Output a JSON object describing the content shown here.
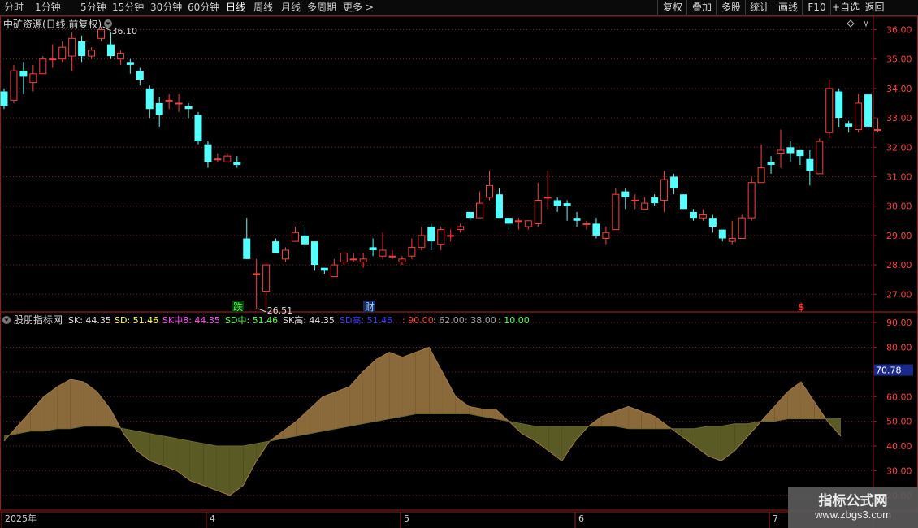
{
  "toolbar": {
    "periods": [
      "分时",
      "1分钟",
      "5分钟",
      "15分钟",
      "30分钟",
      "60分钟",
      "日线",
      "周线",
      "月线",
      "多周期",
      "更多 >"
    ],
    "active_period": "日线",
    "buttons": [
      "复权",
      "叠加",
      "多股",
      "统计",
      "画线",
      "F10",
      "+自选",
      "返回"
    ]
  },
  "main_panel": {
    "title": "中矿资源(日线,前复权)",
    "high_label": "36.10",
    "low_label": "26.51",
    "markers": {
      "die": "跌",
      "cai": "财",
      "dollar": "$"
    }
  },
  "indicator_panel": {
    "name": "股朋指标网",
    "legend": [
      {
        "text": "SK: 44.35",
        "color": "#e0e0e0"
      },
      {
        "text": "SD: 51.46",
        "color": "#ffff4f"
      },
      {
        "text": "SK中8: 44.35",
        "color": "#ff4fff"
      },
      {
        "text": "SD中: 51.46",
        "color": "#4fff4f"
      },
      {
        "text": "SK高: 44.35",
        "color": "#e0e0e0"
      },
      {
        "text": "SD高: 51.46",
        "color": "#3c3cff"
      },
      {
        "text": ": 90.00",
        "color": "#ff4040"
      },
      {
        "text": ": 62.00",
        "color": "#a0a0a0"
      },
      {
        "text": ": 38.00",
        "color": "#a0a0a0"
      },
      {
        "text": ": 10.00",
        "color": "#4fff4f"
      }
    ],
    "current_value": "70.78"
  },
  "x_axis_labels": [
    {
      "text": "2025年",
      "idx": 0
    },
    {
      "text": "4",
      "idx": 21
    },
    {
      "text": "5",
      "idx": 41
    },
    {
      "text": "6",
      "idx": 59
    },
    {
      "text": "7",
      "idx": 79
    }
  ],
  "watermark": {
    "line1": "指标公式网",
    "line2": "www.zbgs3.com"
  },
  "colors": {
    "up": "#ff3c3c",
    "down": "#54ffff",
    "grid": "#7a1a1a",
    "frame": "#9a1a1a",
    "sk_fill": "#8a6a3a",
    "sd_fill": "#5a5a24"
  },
  "chart_data": {
    "type": "candlestick",
    "price_axis": {
      "min": 26.4,
      "max": 36.4,
      "ticks": [
        27.0,
        28.0,
        29.0,
        30.0,
        31.0,
        32.0,
        33.0,
        34.0,
        35.0,
        36.0
      ]
    },
    "indicator_axis": {
      "min": 14.0,
      "max": 94.0,
      "ticks": [
        20.0,
        30.0,
        40.0,
        50.0,
        60.0,
        70.0,
        80.0,
        90.0
      ]
    },
    "candles": [
      [
        33.9,
        33.4,
        34.0,
        33.3
      ],
      [
        33.6,
        34.6,
        34.8,
        33.5
      ],
      [
        34.6,
        34.4,
        34.9,
        33.8
      ],
      [
        34.2,
        34.5,
        34.8,
        33.9
      ],
      [
        34.5,
        35.0,
        35.1,
        34.5
      ],
      [
        35.0,
        35.0,
        35.5,
        34.7
      ],
      [
        35.0,
        35.4,
        35.6,
        34.9
      ],
      [
        35.1,
        35.7,
        35.9,
        34.6
      ],
      [
        35.6,
        35.1,
        35.8,
        34.9
      ],
      [
        35.1,
        35.3,
        35.4,
        35.0
      ],
      [
        35.7,
        36.0,
        36.1,
        35.6
      ],
      [
        35.5,
        35.1,
        35.9,
        35.0
      ],
      [
        35.0,
        35.2,
        35.3,
        34.8
      ],
      [
        34.9,
        34.8,
        35.0,
        34.5
      ],
      [
        34.6,
        34.3,
        34.7,
        34.1
      ],
      [
        34.0,
        33.3,
        34.1,
        33.0
      ],
      [
        33.5,
        33.1,
        33.7,
        32.7
      ],
      [
        33.6,
        33.6,
        33.8,
        33.3
      ],
      [
        33.5,
        33.5,
        33.8,
        33.2
      ],
      [
        33.4,
        33.3,
        33.5,
        33.0
      ],
      [
        33.1,
        32.2,
        33.2,
        32.1
      ],
      [
        32.1,
        31.5,
        32.2,
        31.3
      ],
      [
        31.6,
        31.6,
        31.8,
        31.5
      ],
      [
        31.5,
        31.7,
        31.8,
        31.5
      ],
      [
        31.5,
        31.4,
        31.7,
        31.3
      ],
      [
        28.9,
        28.2,
        29.6,
        28.2
      ],
      [
        27.7,
        27.7,
        28.2,
        26.5
      ],
      [
        27.1,
        28.0,
        28.1,
        26.5
      ],
      [
        28.8,
        28.4,
        28.9,
        28.4
      ],
      [
        28.2,
        28.5,
        28.6,
        28.1
      ],
      [
        28.8,
        29.1,
        29.3,
        28.8
      ],
      [
        29.0,
        28.7,
        29.3,
        28.6
      ],
      [
        28.8,
        28.0,
        28.8,
        27.8
      ],
      [
        27.9,
        27.8,
        27.9,
        27.7
      ],
      [
        27.6,
        28.0,
        28.2,
        27.6
      ],
      [
        28.1,
        28.4,
        28.4,
        28.0
      ],
      [
        28.2,
        28.2,
        28.4,
        28.1
      ],
      [
        28.1,
        28.2,
        28.4,
        27.9
      ],
      [
        28.6,
        28.5,
        28.9,
        28.3
      ],
      [
        28.3,
        28.5,
        29.1,
        28.2
      ],
      [
        28.3,
        28.3,
        28.5,
        28.2
      ],
      [
        28.1,
        28.2,
        28.3,
        28.0
      ],
      [
        28.3,
        28.6,
        28.9,
        28.2
      ],
      [
        28.6,
        29.0,
        29.3,
        28.5
      ],
      [
        29.3,
        28.8,
        29.4,
        28.5
      ],
      [
        28.7,
        29.2,
        29.3,
        28.5
      ],
      [
        29.0,
        29.0,
        29.2,
        28.8
      ],
      [
        29.2,
        29.3,
        29.4,
        29.1
      ],
      [
        29.8,
        29.6,
        29.8,
        29.5
      ],
      [
        29.6,
        30.1,
        30.5,
        29.6
      ],
      [
        30.3,
        30.7,
        31.2,
        30.2
      ],
      [
        30.4,
        29.6,
        30.6,
        29.6
      ],
      [
        29.6,
        29.4,
        29.6,
        29.2
      ],
      [
        29.5,
        29.5,
        29.6,
        29.2
      ],
      [
        29.3,
        29.5,
        29.5,
        29.2
      ],
      [
        29.4,
        30.2,
        30.8,
        29.3
      ],
      [
        30.3,
        30.3,
        31.2,
        29.9
      ],
      [
        30.2,
        30.0,
        30.3,
        29.8
      ],
      [
        30.1,
        30.0,
        30.2,
        29.5
      ],
      [
        29.6,
        29.5,
        29.8,
        29.3
      ],
      [
        29.4,
        29.4,
        29.5,
        29.2
      ],
      [
        29.4,
        29.0,
        29.6,
        28.9
      ],
      [
        28.9,
        29.1,
        29.3,
        28.7
      ],
      [
        29.2,
        30.4,
        30.6,
        29.2
      ],
      [
        30.5,
        30.3,
        30.6,
        29.9
      ],
      [
        30.2,
        30.2,
        30.4,
        29.9
      ],
      [
        29.9,
        30.1,
        30.3,
        29.9
      ],
      [
        30.3,
        30.1,
        30.4,
        30.0
      ],
      [
        30.2,
        30.9,
        31.2,
        29.8
      ],
      [
        31.0,
        30.6,
        31.1,
        30.4
      ],
      [
        30.4,
        29.9,
        30.4,
        29.9
      ],
      [
        29.8,
        29.6,
        29.9,
        29.5
      ],
      [
        29.6,
        29.7,
        29.9,
        29.5
      ],
      [
        29.6,
        29.3,
        29.7,
        29.1
      ],
      [
        29.2,
        28.9,
        29.2,
        28.8
      ],
      [
        28.8,
        28.9,
        29.5,
        28.7
      ],
      [
        28.9,
        29.6,
        29.7,
        28.9
      ],
      [
        29.6,
        30.8,
        31.0,
        29.5
      ],
      [
        30.8,
        31.3,
        32.1,
        30.8
      ],
      [
        31.5,
        31.4,
        31.7,
        31.1
      ],
      [
        31.8,
        31.9,
        32.6,
        31.3
      ],
      [
        32.0,
        31.8,
        32.2,
        31.5
      ],
      [
        31.9,
        31.7,
        31.9,
        31.4
      ],
      [
        31.6,
        31.2,
        31.9,
        30.7
      ],
      [
        31.1,
        32.2,
        32.3,
        31.1
      ],
      [
        32.5,
        34.0,
        34.3,
        32.3
      ],
      [
        33.9,
        33.0,
        34.0,
        32.7
      ],
      [
        32.8,
        32.7,
        32.9,
        32.5
      ],
      [
        32.6,
        33.5,
        33.8,
        32.5
      ],
      [
        33.8,
        32.7,
        33.8,
        32.6
      ],
      [
        32.6,
        32.6,
        33.0,
        32.5
      ]
    ],
    "sk_series": [
      42,
      48,
      54,
      60,
      64,
      67,
      66,
      62,
      55,
      45,
      38,
      34,
      32,
      30,
      26,
      24,
      22,
      20,
      24,
      34,
      42,
      46,
      50,
      55,
      60,
      62,
      64,
      70,
      75,
      78,
      76,
      78,
      80,
      70,
      60,
      56,
      55,
      55,
      50,
      45,
      42,
      38,
      34,
      42,
      48,
      52,
      54,
      56,
      54,
      52,
      48,
      44,
      40,
      36,
      34,
      38,
      44,
      50,
      56,
      62,
      66,
      58,
      50,
      44
    ],
    "sd_series": [
      44,
      45,
      46,
      46,
      47,
      47,
      48,
      48,
      48,
      47,
      46,
      45,
      44,
      43,
      42,
      41,
      40,
      40,
      40,
      41,
      42,
      43,
      44,
      45,
      46,
      47,
      48,
      49,
      50,
      51,
      52,
      53,
      53,
      53,
      53,
      53,
      52,
      51,
      50,
      49,
      48,
      48,
      48,
      48,
      48,
      48,
      48,
      47,
      47,
      47,
      47,
      47,
      47,
      48,
      48,
      49,
      49,
      50,
      50,
      51,
      51,
      51,
      51,
      51
    ]
  }
}
